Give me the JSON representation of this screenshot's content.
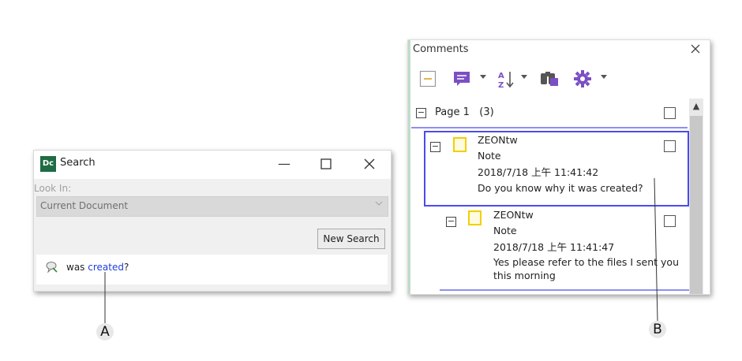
{
  "search_window": {
    "app_logo": "Dc",
    "title": "Search",
    "minimize": "—",
    "maximize": "☐",
    "close": "✕",
    "look_in_label": "Look In:",
    "look_in_value": "Current Document",
    "dropdown_arrow": "⌄",
    "new_search_label": "New Search",
    "result": {
      "prefix": "was ",
      "highlight": "created",
      "suffix": "?"
    }
  },
  "comments_panel": {
    "title": "Comments",
    "close": "✕",
    "toolbar": [
      "collapse-all-icon",
      "comment-filter-icon",
      "sort-icon",
      "search-comments-icon",
      "options-gear-icon"
    ],
    "page": {
      "label": "Page 1",
      "count": "(3)",
      "expander": "⊟"
    },
    "comments": [
      {
        "author": "ZEONtw",
        "type": "Note",
        "date": "2018/7/18 上午 11:41:42",
        "text": "Do you know why it was created?"
      },
      {
        "author": "ZEONtw",
        "type": "Note",
        "date": "2018/7/18 上午 11:41:47",
        "text_line1": "Yes please refer to the files I sent you",
        "text_line2": "this morning"
      }
    ],
    "scroll_up": "▲"
  },
  "callouts": {
    "a": "A",
    "b": "B"
  },
  "colors": {
    "highlight_blue": "#1f3fd8",
    "selected_border": "#4a4af0",
    "toolbar_purple": "#7b4fc4",
    "note_yellow": "#f0d000",
    "logo_green": "#1f6b44"
  }
}
